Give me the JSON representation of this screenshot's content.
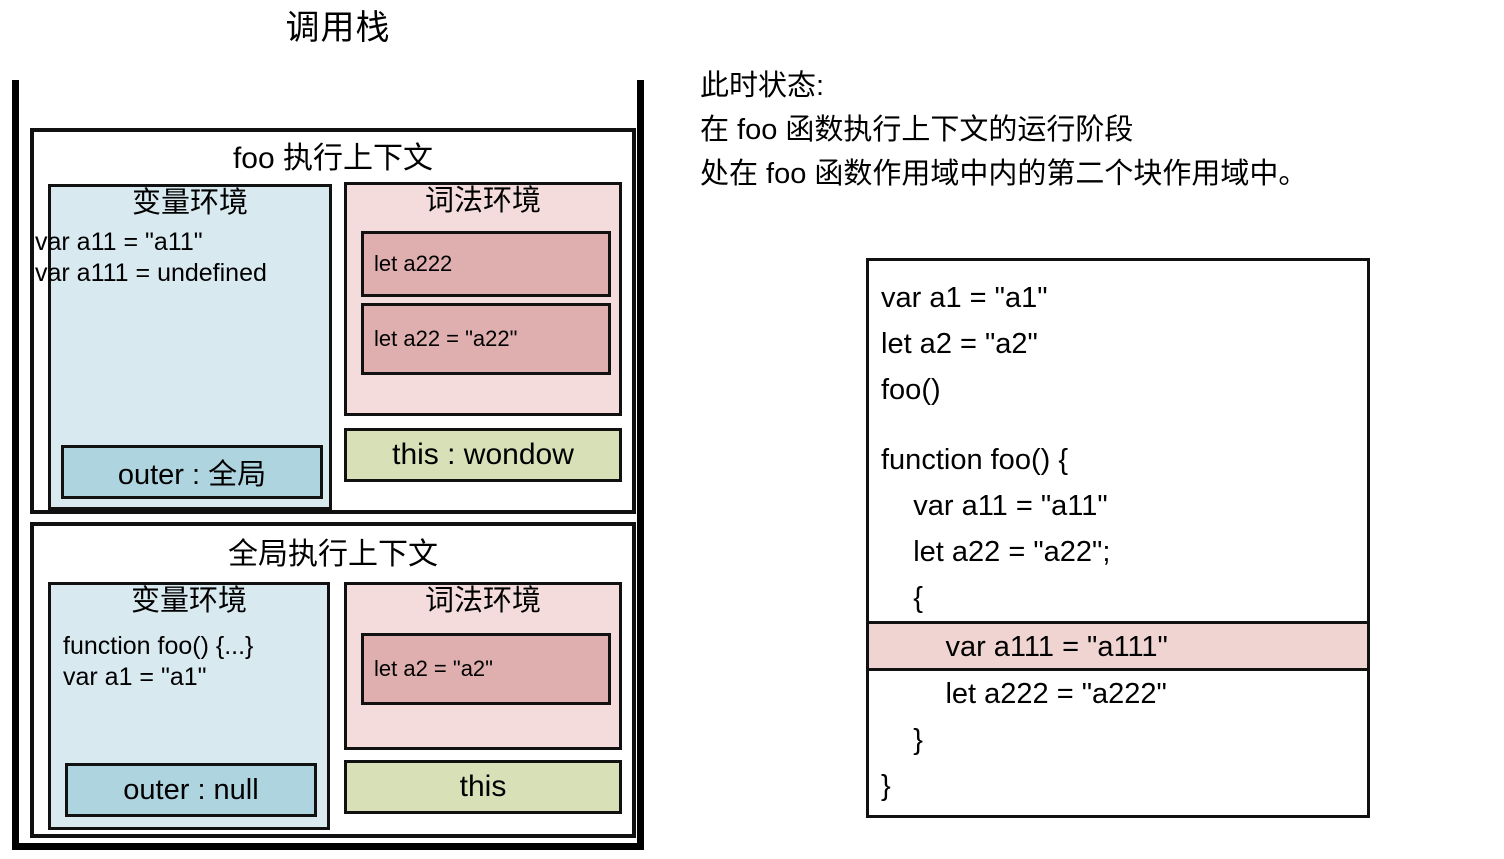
{
  "colors": {
    "variable_env_bg": "#d8e9f0",
    "lexical_env_bg": "#f4dcdc",
    "lexical_chip_bg": "#dfafaf",
    "outer_chip_bg": "#aed4e0",
    "this_chip_bg": "#d8e0b8",
    "highlight_bg": "#f0d4d2",
    "border": "#111111",
    "page_bg": "#ffffff"
  },
  "stack": {
    "title": "调用栈",
    "contexts": [
      {
        "id": "foo",
        "title": "foo 执行上下文",
        "variable_environment": {
          "title": "变量环境",
          "entries": [
            "var a11 = \"a11\"",
            "var a111 = undefined"
          ],
          "outer": "outer : 全局"
        },
        "lexical_environment": {
          "title": "词法环境",
          "entries": [
            "let a222",
            "let a22 = \"a22\""
          ],
          "this": "this : wondow"
        }
      },
      {
        "id": "global",
        "title": "全局执行上下文",
        "variable_environment": {
          "title": "变量环境",
          "entries": [
            "function foo() {...}",
            "var a1 = \"a1\""
          ],
          "outer": "outer : null"
        },
        "lexical_environment": {
          "title": "词法环境",
          "entries": [
            "let a2 = \"a2\""
          ],
          "this": "this"
        }
      }
    ]
  },
  "note": {
    "lines": [
      "此时状态:",
      "在 foo 函数执行上下文的运行阶段",
      "处在 foo 函数作用域中内的第二个块作用域中。"
    ]
  },
  "code": {
    "lines": [
      {
        "text": "var a1 = \"a1\"",
        "highlight": false,
        "blank": false
      },
      {
        "text": "let a2 = \"a2\"",
        "highlight": false,
        "blank": false
      },
      {
        "text": "foo()",
        "highlight": false,
        "blank": false
      },
      {
        "text": "",
        "highlight": false,
        "blank": true
      },
      {
        "text": "function foo() {",
        "highlight": false,
        "blank": false
      },
      {
        "text": "    var a11 = \"a11\"",
        "highlight": false,
        "blank": false
      },
      {
        "text": "    let a22 = \"a22\";",
        "highlight": false,
        "blank": false
      },
      {
        "text": "    {",
        "highlight": false,
        "blank": false
      },
      {
        "text": "        var a111 = \"a111\"",
        "highlight": true,
        "blank": false
      },
      {
        "text": "        let a222 = \"a222\"",
        "highlight": false,
        "blank": false
      },
      {
        "text": "    }",
        "highlight": false,
        "blank": false
      },
      {
        "text": "}",
        "highlight": false,
        "blank": false
      }
    ]
  }
}
